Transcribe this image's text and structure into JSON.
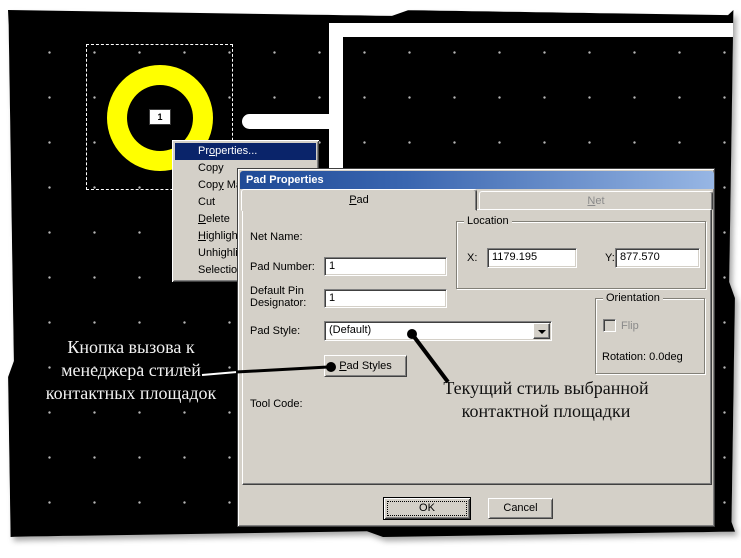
{
  "editor": {
    "pad_number": "1",
    "annotation_left": [
      "Кнопка вызова к",
      "менеджера стилей",
      "контактных площадок"
    ],
    "annotation_right": [
      "Текущий стиль выбранной",
      "контактной площадки"
    ]
  },
  "context_menu": {
    "items": [
      "Properties...",
      "Copy",
      "Copy Ma",
      "Cut",
      "Delete",
      "Highligh",
      "Unhighli",
      "Selectio"
    ]
  },
  "dialog": {
    "title": "Pad Properties",
    "tabs": [
      "Pad",
      "Net"
    ],
    "net_name_label": "Net Name:",
    "pad_number_label": "Pad Number:",
    "pad_number_value": "1",
    "default_pin_line1": "Default Pin",
    "default_pin_line2": "Designator:",
    "default_pin_value": "1",
    "pad_style_label": "Pad Style:",
    "pad_style_value": "(Default)",
    "pad_styles_button": "Pad Styles",
    "tool_code_label": "Tool Code:",
    "location": {
      "title": "Location",
      "x_label": "X:",
      "x_value": "1179.195",
      "y_label": "Y:",
      "y_value": "877.570"
    },
    "orientation": {
      "title": "Orientation",
      "flip_label": "Flip",
      "rotation_text": "Rotation:  0.0deg"
    },
    "ok_label": "OK",
    "cancel_label": "Cancel"
  },
  "colors": {
    "editor_bg": "#000000",
    "pad_yellow": "#ffff00",
    "dialog_bg": "#d4d0c8",
    "menu_highlight": "#0a246a",
    "titlebar_gradient_left": "#1f4a96",
    "titlebar_gradient_right": "#97b6e4"
  }
}
